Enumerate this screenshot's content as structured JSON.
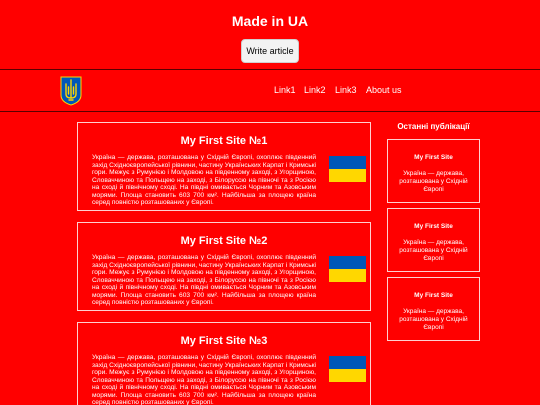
{
  "header": {
    "title": "Made in UA",
    "write_button": "Write article"
  },
  "nav": {
    "logo_icon": "ukraine-trident-coat-of-arms-icon",
    "links": [
      "Link1",
      "Link2",
      "Link3",
      "About us"
    ]
  },
  "colors": {
    "background": "#ff0000",
    "flag_blue": "#0057b8",
    "flag_yellow": "#ffd700",
    "button_bg": "#f3f3f3"
  },
  "articles": [
    {
      "title": "My First Site №1",
      "text": "Україна — держава, розташована у Східній Європі, охоплює південний захід Східноєвропейської рівнини, частину Українських Карпат і Кримські гори. Межує з Румунією і Молдовою на південному заході, з Угорщиною, Словаччиною та Польщею на заході, з Білоруссю на півночі та з Росією на сході й північному сході. На півдні омивається Чорним та Азовським морями. Площа становить 603 700 км². Найбільша за площею країна серед повністю розташованих у Європі."
    },
    {
      "title": "My First Site №2",
      "text": "Україна — держава, розташована у Східній Європі, охоплює південний захід Східноєвропейської рівнини, частину Українських Карпат і Кримські гори. Межує з Румунією і Молдовою на південному заході, з Угорщиною, Словаччиною та Польщею на заході, з Білоруссю на півночі та з Росією на сході й північному сході. На півдні омивається Чорним та Азовським морями. Площа становить 603 700 км². Найбільша за площею країна серед повністю розташованих у Європі."
    },
    {
      "title": "My First Site №3",
      "text": "Україна — держава, розташована у Східній Європі, охоплює південний захід Східноєвропейської рівнини, частину Українських Карпат і Кримські гори. Межує з Румунією і Молдовою на південному заході, з Угорщиною, Словаччиною та Польщею на заході, з Білоруссю на півночі та з Росією на сході й північному сході. На півдні омивається Чорним та Азовським морями. Площа становить 603 700 км². Найбільша за площею країна серед повністю розташованих у Європі."
    }
  ],
  "sidebar": {
    "title": "Останні публікації",
    "cards": [
      {
        "title": "My First Site",
        "text": "Україна — держава, розташована у Східній Європі"
      },
      {
        "title": "My First Site",
        "text": "Україна — держава, розташована у Східній Європі"
      },
      {
        "title": "My First Site",
        "text": "Україна — держава, розташована у Східній Європі"
      }
    ]
  }
}
